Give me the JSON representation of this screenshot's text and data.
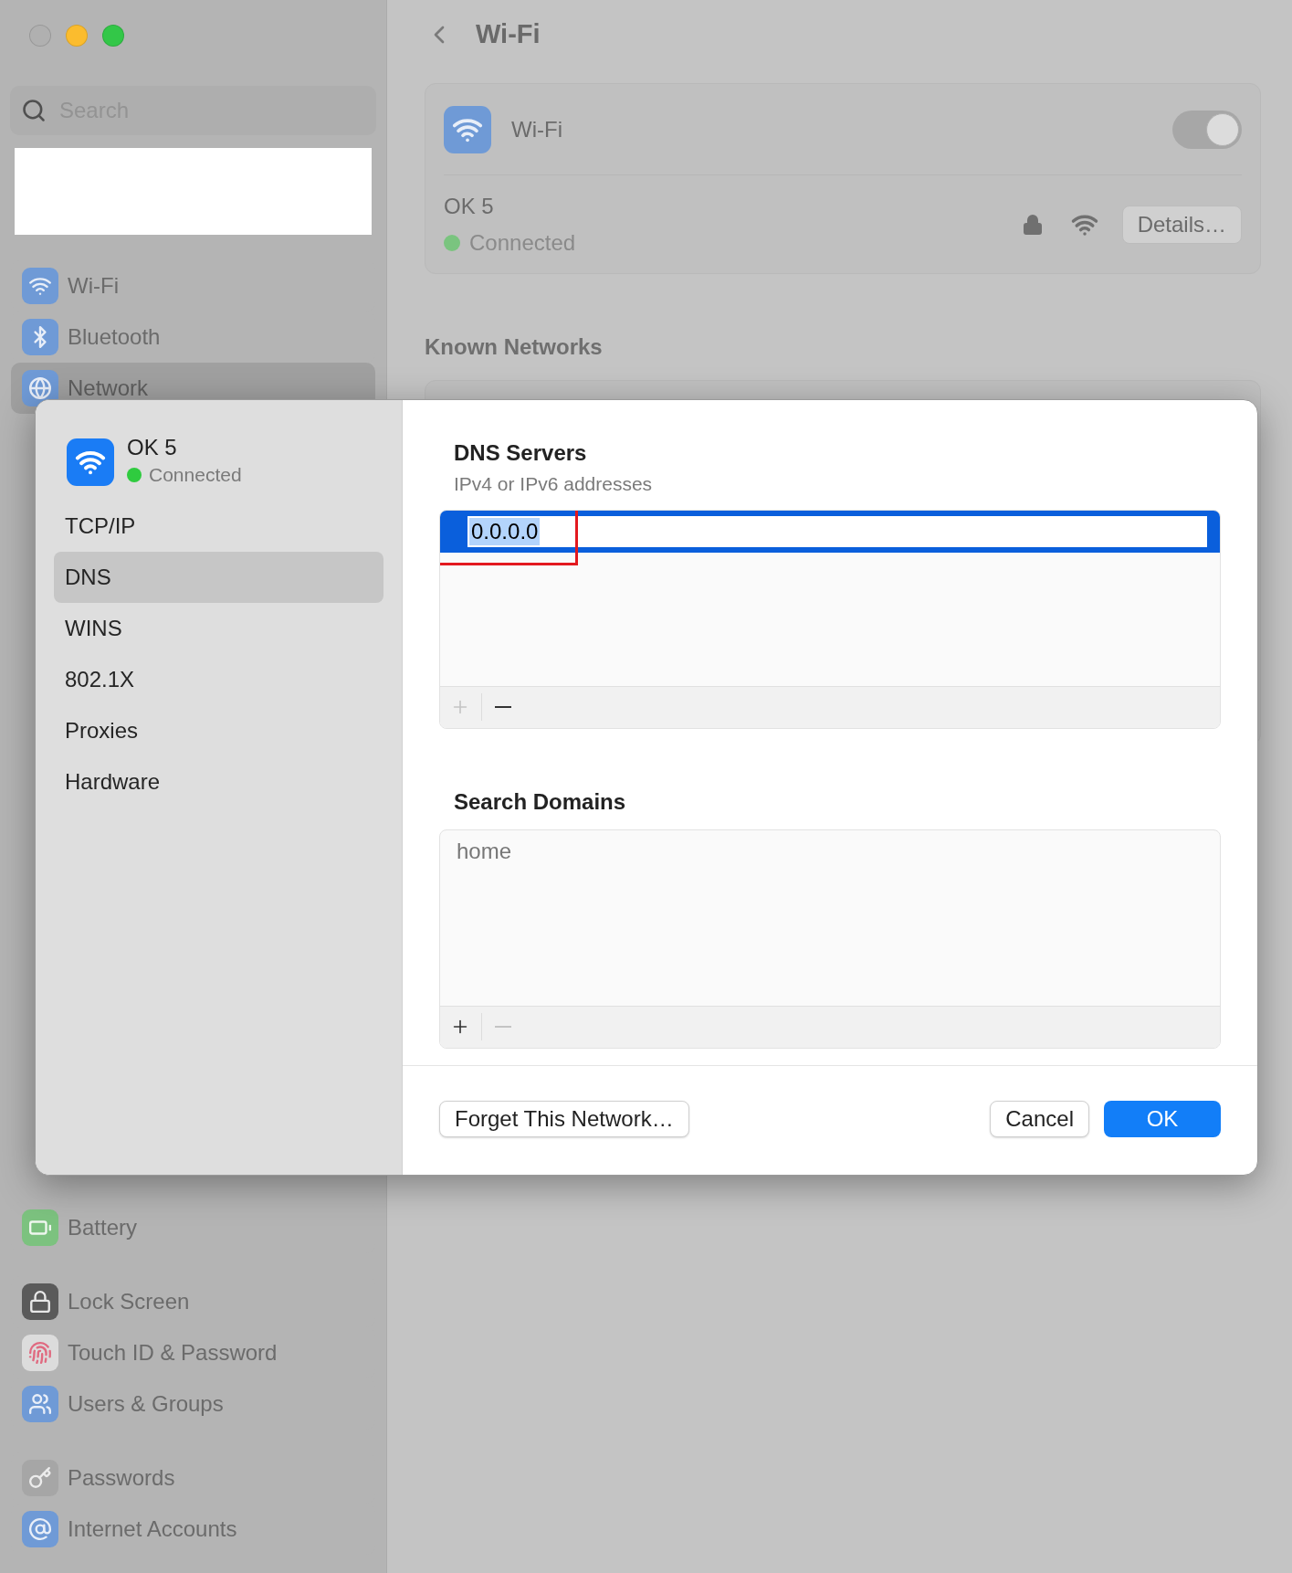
{
  "window": {
    "controls": [
      {
        "color": "#b0b0b0"
      },
      {
        "color": "#fbbc2e"
      },
      {
        "color": "#33c748"
      }
    ]
  },
  "sidebar": {
    "search": {
      "placeholder": "Search"
    },
    "groups": [
      {
        "items": [
          {
            "label": "Wi-Fi",
            "kind": "wifi",
            "selected": false
          },
          {
            "label": "Bluetooth",
            "kind": "bluetooth",
            "selected": false
          },
          {
            "label": "Network",
            "kind": "network",
            "selected": true
          }
        ]
      },
      {
        "items": [
          {
            "label": "Battery",
            "kind": "battery",
            "selected": false
          }
        ]
      },
      {
        "items": [
          {
            "label": "Lock Screen",
            "kind": "lock",
            "selected": false
          },
          {
            "label": "Touch ID & Password",
            "kind": "fingerprint",
            "selected": false
          },
          {
            "label": "Users & Groups",
            "kind": "users",
            "selected": false
          }
        ]
      },
      {
        "items": [
          {
            "label": "Passwords",
            "kind": "key",
            "selected": false
          },
          {
            "label": "Internet Accounts",
            "kind": "at",
            "selected": false
          }
        ]
      }
    ]
  },
  "main": {
    "title": "Wi-Fi",
    "wifi_card": {
      "label": "Wi-Fi",
      "on": true,
      "network": {
        "name": "OK 5",
        "status": "Connected",
        "details_button": "Details…"
      }
    },
    "known_networks": {
      "heading": "Known Networks"
    }
  },
  "dialog": {
    "network": {
      "name": "OK 5",
      "status": "Connected"
    },
    "nav": [
      {
        "label": "TCP/IP",
        "selected": false
      },
      {
        "label": "DNS",
        "selected": true
      },
      {
        "label": "WINS",
        "selected": false
      },
      {
        "label": "802.1X",
        "selected": false
      },
      {
        "label": "Proxies",
        "selected": false
      },
      {
        "label": "Hardware",
        "selected": false
      }
    ],
    "dns_servers": {
      "heading": "DNS Servers",
      "subtitle": "IPv4 or IPv6 addresses",
      "entries": [
        {
          "value": "0.0.0.0",
          "selected": true,
          "marked": true
        }
      ],
      "add_enabled": false,
      "remove_enabled": true
    },
    "search_domains": {
      "heading": "Search Domains",
      "entries": [
        {
          "value": "home",
          "selected": false,
          "marked": false
        }
      ],
      "add_enabled": true,
      "remove_enabled": false
    },
    "buttons": [
      {
        "label": "Forget This Network…",
        "kind": "secondary"
      },
      {
        "label": "Cancel",
        "kind": "secondary"
      },
      {
        "label": "OK",
        "kind": "primary"
      }
    ]
  }
}
